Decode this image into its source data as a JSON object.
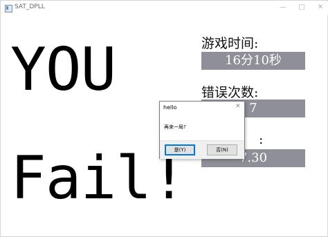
{
  "window": {
    "title": "SAT_DPLL",
    "min_glyph": "—",
    "max_glyph": "□",
    "close_glyph": "✕"
  },
  "game": {
    "line1": "YOU",
    "line2": "Fail!"
  },
  "stats": {
    "time_label": "游戏时间:",
    "time_value": "16分10秒",
    "errors_label": "错误次数:",
    "errors_value": "7",
    "third_label": ":",
    "third_value": "7.30"
  },
  "dialog": {
    "title": "hello",
    "close_glyph": "✕",
    "message": "再来一局?",
    "yes_label": "是(Y)",
    "no_label": "否(N)"
  }
}
